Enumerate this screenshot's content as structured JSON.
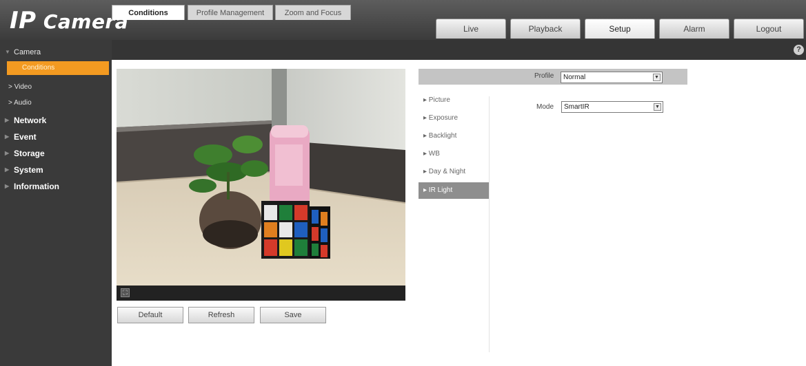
{
  "app": {
    "brand_prefix": "IP",
    "brand_suffix": " Camera"
  },
  "nav": {
    "tabs": [
      {
        "label": "Live"
      },
      {
        "label": "Playback"
      },
      {
        "label": "Setup",
        "active": true
      },
      {
        "label": "Alarm"
      },
      {
        "label": "Logout"
      }
    ]
  },
  "sidebar": {
    "camera": "Camera",
    "conditions": "Conditions",
    "video": "> Video",
    "audio": "> Audio",
    "network": "Network",
    "event": "Event",
    "storage": "Storage",
    "system": "System",
    "information": "Information"
  },
  "subtabs": {
    "conditions": "Conditions",
    "profile_management": "Profile Management",
    "zoom_focus": "Zoom and Focus"
  },
  "help_icon": "?",
  "video": {
    "fullscreen_glyph": "⛶"
  },
  "buttons": {
    "default": "Default",
    "refresh": "Refresh",
    "save": "Save"
  },
  "profile": {
    "label": "Profile",
    "value": "Normal"
  },
  "settings_menu": {
    "picture": "▸ Picture",
    "exposure": "▸ Exposure",
    "backlight": "▸ Backlight",
    "wb": "▸ WB",
    "day_night": "▸ Day & Night",
    "ir_light": "▸ IR Light"
  },
  "ir_light": {
    "mode_label": "Mode",
    "mode_value": "SmartIR"
  },
  "colors": {
    "accent": "#f39a21",
    "header": "#4a4a4a",
    "sidebar": "#3a3a3a"
  }
}
